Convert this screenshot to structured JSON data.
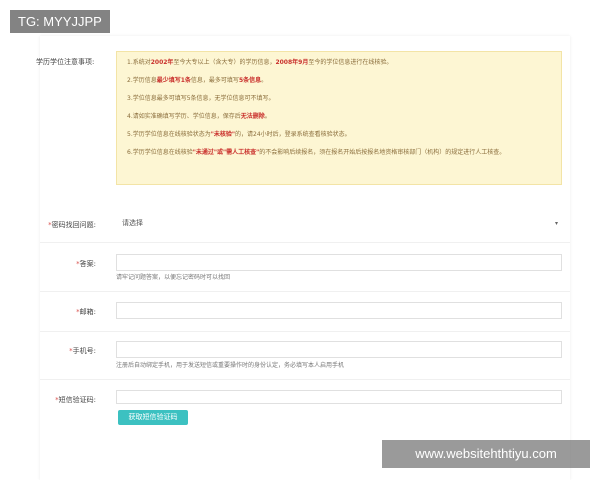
{
  "watermark_top": "TG: MYYJJPP",
  "watermark_bottom": "www.websitehthtiyu.com",
  "notice_section": {
    "label": "学历学位注意事项:",
    "items": [
      {
        "parts": [
          "1.系统对",
          "2002年",
          "至今大专以上（含大专）的学历信息，",
          "2008年9月",
          "至今的学位信息进行在线核验。"
        ]
      },
      {
        "parts": [
          "2.学历信息",
          "最少填写1条",
          "信息，最多可填写",
          "5条信息",
          "。"
        ]
      },
      {
        "text": "3.学位信息最多可填写5条信息，无学位信息可不填写。"
      },
      {
        "parts": [
          "4.请如实准确填写学历、学位信息，保存后",
          "无法删除",
          "。"
        ]
      },
      {
        "parts": [
          "5.学历学位信息在线核验状态为",
          "\"未核验\"",
          "的，请24小时后，登录系统查看核验状态。"
        ]
      },
      {
        "parts": [
          "6.学历学位信息在线核验",
          "\"未通过\"或\"需人工核查\"",
          "的不会影响后续报名，须在报名开始后按报名地资格审核部门（机构）的规定进行人工核查。"
        ]
      }
    ]
  },
  "form": {
    "security_question": {
      "label": "密码找回问题:",
      "required": "*",
      "value": "请选择",
      "arrow": "▾"
    },
    "answer": {
      "label": "答案:",
      "required": "*",
      "hint": "请牢记问题答案，以便忘记密码时可以找回"
    },
    "email": {
      "label": "邮箱:",
      "required": "*"
    },
    "phone": {
      "label": "手机号:",
      "required": "*",
      "hint": "注册后自动绑定手机，用于发送短信或重要操作时的身份认定，务必填写本人启用手机"
    },
    "sms_code": {
      "label": "短信验证码:",
      "required": "*",
      "button": "获取短信验证码"
    }
  }
}
